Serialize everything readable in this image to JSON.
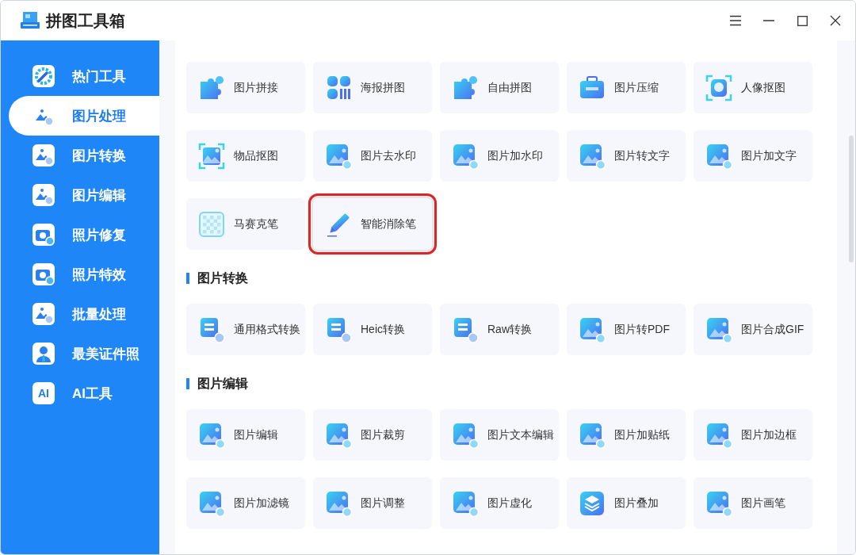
{
  "window": {
    "title": "拼图工具箱"
  },
  "sidebar": {
    "items": [
      {
        "label": "热门工具",
        "selected": false
      },
      {
        "label": "图片处理",
        "selected": true
      },
      {
        "label": "图片转换",
        "selected": false
      },
      {
        "label": "图片编辑",
        "selected": false
      },
      {
        "label": "照片修复",
        "selected": false
      },
      {
        "label": "照片特效",
        "selected": false
      },
      {
        "label": "批量处理",
        "selected": false
      },
      {
        "label": "最美证件照",
        "selected": false
      },
      {
        "label": "AI工具",
        "selected": false,
        "icon_text": "AI"
      }
    ]
  },
  "sections": [
    {
      "tools": [
        {
          "label": "图片拼接",
          "highlighted": false
        },
        {
          "label": "海报拼图",
          "highlighted": false
        },
        {
          "label": "自由拼图",
          "highlighted": false
        },
        {
          "label": "图片压缩",
          "highlighted": false
        },
        {
          "label": "人像抠图",
          "highlighted": false
        },
        {
          "label": "物品抠图",
          "highlighted": false
        },
        {
          "label": "图片去水印",
          "highlighted": false
        },
        {
          "label": "图片加水印",
          "highlighted": false
        },
        {
          "label": "图片转文字",
          "highlighted": false
        },
        {
          "label": "图片加文字",
          "highlighted": false
        },
        {
          "label": "马赛克笔",
          "highlighted": false
        },
        {
          "label": "智能消除笔",
          "highlighted": true
        }
      ]
    },
    {
      "title": "图片转换",
      "tools": [
        {
          "label": "通用格式转换",
          "highlighted": false
        },
        {
          "label": "Heic转换",
          "highlighted": false
        },
        {
          "label": "Raw转换",
          "highlighted": false
        },
        {
          "label": "图片转PDF",
          "highlighted": false
        },
        {
          "label": "图片合成GIF",
          "highlighted": false
        }
      ]
    },
    {
      "title": "图片编辑",
      "tools": [
        {
          "label": "图片编辑",
          "highlighted": false
        },
        {
          "label": "图片裁剪",
          "highlighted": false
        },
        {
          "label": "图片文本编辑",
          "highlighted": false
        },
        {
          "label": "图片加贴纸",
          "highlighted": false
        },
        {
          "label": "图片加边框",
          "highlighted": false
        },
        {
          "label": "图片加滤镜",
          "highlighted": false
        },
        {
          "label": "图片调整",
          "highlighted": false
        },
        {
          "label": "图片虚化",
          "highlighted": false
        },
        {
          "label": "图片叠加",
          "highlighted": false
        },
        {
          "label": "图片画笔",
          "highlighted": false
        }
      ]
    }
  ]
}
